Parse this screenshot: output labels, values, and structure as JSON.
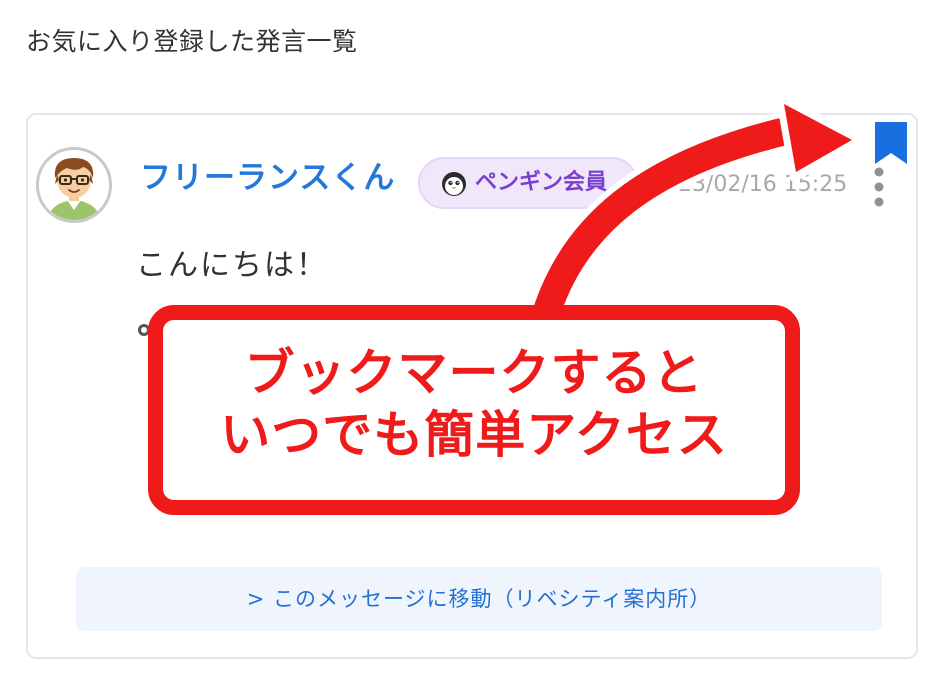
{
  "page": {
    "title": "お気に入り登録した発言一覧"
  },
  "post": {
    "author_name": "フリーランスくん",
    "badge_label": "ペンギン会員",
    "badge_icon": "penguin-icon",
    "timestamp": "2023/02/16 15:25",
    "message": "こんにちは！",
    "bookmark_icon": "bookmark-icon",
    "more_icon": "more-vertical-icon",
    "jump_link_label": "> このメッセージに移動（リベシティ案内所）"
  },
  "callout": {
    "line1": "ブックマークすると",
    "line2": "いつでも簡単アクセス"
  },
  "colors": {
    "author": "#2379d8",
    "badge_bg": "#f0e7fb",
    "badge_text": "#7b3fd0",
    "bookmark": "#1a6fe0",
    "callout_red": "#ef1b1b",
    "link_bg": "#f0f5fd",
    "link_text": "#2470d3"
  }
}
